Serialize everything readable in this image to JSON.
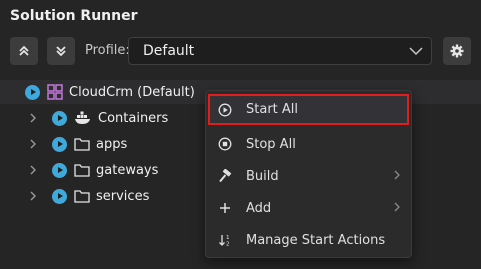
{
  "panel": {
    "title": "Solution Runner"
  },
  "toolbar": {
    "collapse_icon": "chevrons-up-icon",
    "expand_icon": "chevrons-down-icon",
    "profile_label": "Profile:",
    "profile_value": "Default",
    "settings_icon": "gear-icon"
  },
  "tree": {
    "root": {
      "label": "CloudCrm (Default)",
      "icon": "solution-icon"
    },
    "items": [
      {
        "label": "Containers",
        "icon": "docker-icon"
      },
      {
        "label": "apps",
        "icon": "folder-icon"
      },
      {
        "label": "gateways",
        "icon": "folder-icon"
      },
      {
        "label": "services",
        "icon": "folder-icon"
      }
    ]
  },
  "context_menu": {
    "items": [
      {
        "label": "Start All",
        "icon": "play-circle-icon",
        "highlighted": true
      },
      {
        "label": "Stop All",
        "icon": "stop-circle-icon"
      },
      {
        "label": "Build",
        "icon": "hammer-icon",
        "submenu": true
      },
      {
        "label": "Add",
        "icon": "plus-icon",
        "submenu": true
      },
      {
        "label": "Manage Start Actions",
        "icon": "sort-icon"
      }
    ]
  },
  "colors": {
    "accent": "#3fa9dc",
    "highlight_border": "#e21d1d",
    "solution_icon": "#c678dd"
  }
}
